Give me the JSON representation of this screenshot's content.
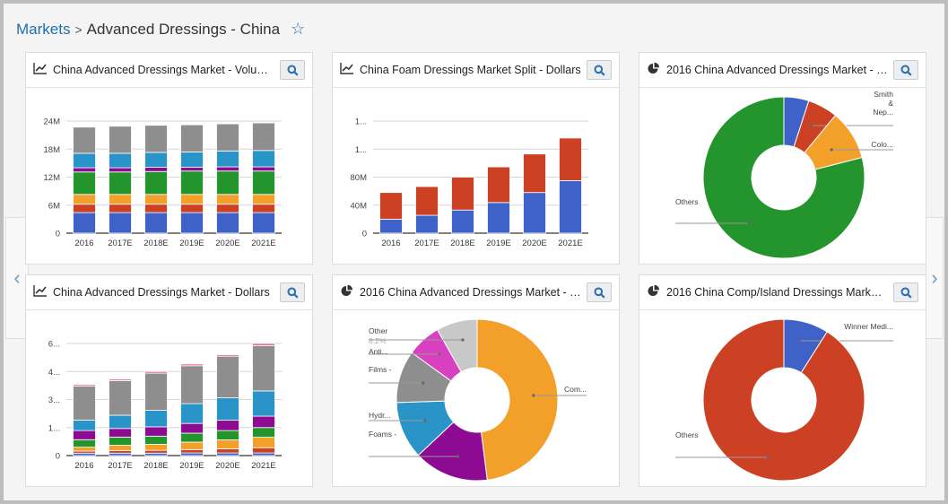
{
  "breadcrumb": {
    "root": "Markets",
    "separator": ">",
    "current": "Advanced Dressings - China"
  },
  "icons": {
    "favorite": "star-outline-icon",
    "line_chart": "line-chart-icon",
    "pie_chart": "pie-chart-icon",
    "search": "search-icon",
    "prev": "chevron-left-icon",
    "next": "chevron-right-icon"
  },
  "nav": {
    "prev": "‹",
    "next": "›",
    "star": "☆"
  },
  "cards": [
    {
      "title": "China Advanced Dressings Market - Volumes"
    },
    {
      "title": "China Foam Dressings Market Split - Dollars"
    },
    {
      "title": "2016 China Advanced Dressings Market - Revenue"
    },
    {
      "title": "China Advanced Dressings Market - Dollars"
    },
    {
      "title": "2016 China Advanced Dressings Market - Segment"
    },
    {
      "title": "2016 China Comp/Island Dressings Market - Revenue"
    }
  ],
  "chart_data": [
    {
      "type": "bar",
      "stacked": true,
      "title": "China Advanced Dressings Market - Volumes",
      "categories": [
        "2016",
        "2017E",
        "2018E",
        "2019E",
        "2020E",
        "2021E"
      ],
      "ylim": [
        0,
        24
      ],
      "yticks": [
        0,
        6,
        12,
        18,
        24
      ],
      "ytick_labels": [
        "0",
        "6M",
        "12M",
        "18M",
        "24M"
      ],
      "grid": true,
      "series": [
        {
          "name": "s1",
          "color": "#3e62c8",
          "values": [
            4.4,
            4.4,
            4.4,
            4.4,
            4.4,
            4.4
          ]
        },
        {
          "name": "s2",
          "color": "#cc4123",
          "values": [
            1.8,
            1.8,
            1.8,
            1.8,
            1.8,
            1.8
          ]
        },
        {
          "name": "s3",
          "color": "#f3a02a",
          "values": [
            2.1,
            2.1,
            2.1,
            2.1,
            2.1,
            2.1
          ]
        },
        {
          "name": "s4",
          "color": "#24942c",
          "values": [
            4.8,
            4.8,
            4.9,
            5.0,
            5.0,
            5.0
          ]
        },
        {
          "name": "s5",
          "color": "#8d0b93",
          "values": [
            0.9,
            0.9,
            0.9,
            0.8,
            0.9,
            0.9
          ]
        },
        {
          "name": "s6",
          "color": "#2a93c8",
          "values": [
            3.1,
            3.1,
            3.2,
            3.3,
            3.4,
            3.5
          ]
        },
        {
          "name": "s7",
          "color": "#8e8e8e",
          "values": [
            5.6,
            5.8,
            5.8,
            5.8,
            5.8,
            5.9
          ]
        }
      ]
    },
    {
      "type": "bar",
      "stacked": true,
      "title": "China Foam Dressings Market Split - Dollars",
      "categories": [
        "2016",
        "2017E",
        "2018E",
        "2019E",
        "2020E",
        "2021E"
      ],
      "ylim": [
        0,
        160
      ],
      "yticks": [
        0,
        40,
        80,
        120,
        160
      ],
      "ytick_labels": [
        "0",
        "40M",
        "80M",
        "1...",
        "1..."
      ],
      "grid": true,
      "series": [
        {
          "name": "s1",
          "color": "#3e62c8",
          "values": [
            20,
            25.5,
            33,
            43.7,
            58,
            75
          ]
        },
        {
          "name": "s2",
          "color": "#cc4123",
          "values": [
            38,
            41,
            47,
            50.9,
            55,
            60.8
          ]
        }
      ]
    },
    {
      "type": "pie",
      "donut": true,
      "title": "2016 China Advanced Dressings Market - Revenue",
      "slices": [
        {
          "label": "",
          "value": 5,
          "color": "#3e62c8"
        },
        {
          "label": "Smith & Nep...",
          "value": 6,
          "color": "#cc4123"
        },
        {
          "label": "Colo...",
          "value": 10,
          "color": "#f3a02a"
        },
        {
          "label": "Others",
          "value": 79,
          "color": "#24942c"
        }
      ]
    },
    {
      "type": "bar",
      "stacked": true,
      "title": "China Advanced Dressings Market - Dollars",
      "categories": [
        "2016",
        "2017E",
        "2018E",
        "2019E",
        "2020E",
        "2021E"
      ],
      "ylim": [
        0,
        6
      ],
      "yticks": [
        0,
        1.5,
        3,
        4.5,
        6
      ],
      "ytick_labels": [
        "0",
        "1...",
        "3...",
        "4...",
        "6..."
      ],
      "grid": true,
      "series": [
        {
          "name": "s1",
          "color": "#3e62c8",
          "values": [
            0.13,
            0.13,
            0.13,
            0.14,
            0.14,
            0.14
          ]
        },
        {
          "name": "s2",
          "color": "#cc4123",
          "values": [
            0.11,
            0.14,
            0.15,
            0.18,
            0.22,
            0.28
          ]
        },
        {
          "name": "s3",
          "color": "#f3a02a",
          "values": [
            0.21,
            0.28,
            0.32,
            0.4,
            0.48,
            0.56
          ]
        },
        {
          "name": "s4",
          "color": "#24942c",
          "values": [
            0.4,
            0.44,
            0.44,
            0.48,
            0.5,
            0.52
          ]
        },
        {
          "name": "s5",
          "color": "#8d0b93",
          "values": [
            0.49,
            0.46,
            0.5,
            0.52,
            0.55,
            0.61
          ]
        },
        {
          "name": "s6",
          "color": "#2a93c8",
          "values": [
            0.56,
            0.71,
            0.88,
            1.06,
            1.2,
            1.35
          ]
        },
        {
          "name": "s7",
          "color": "#8e8e8e",
          "values": [
            1.82,
            1.85,
            1.99,
            2.03,
            2.23,
            2.43
          ]
        },
        {
          "name": "s8",
          "color": "#e75b9e",
          "values": [
            0.08,
            0.08,
            0.09,
            0.09,
            0.08,
            0.11
          ]
        }
      ]
    },
    {
      "type": "pie",
      "donut": true,
      "title": "2016 China Advanced Dressings Market - Segment",
      "slices": [
        {
          "label": "Com...",
          "value": 48,
          "color": "#f3a02a"
        },
        {
          "label": "Foams -",
          "value": 15,
          "color": "#8d0b93"
        },
        {
          "label": "Hydr...",
          "value": 11.5,
          "color": "#2a93c8"
        },
        {
          "label": "Films -",
          "value": 10.5,
          "color": "#8e8e8e"
        },
        {
          "label": "Anti...",
          "value": 6.8,
          "color": "#d940c0"
        },
        {
          "label": "Other",
          "sublabel": "8.2%",
          "value": 8.2,
          "color": "#c8c8c8"
        }
      ]
    },
    {
      "type": "pie",
      "donut": true,
      "title": "2016 China Comp/Island Dressings Market - Revenue",
      "slices": [
        {
          "label": "Winner Medi...",
          "value": 9,
          "color": "#3e62c8"
        },
        {
          "label": "Others",
          "value": 91,
          "color": "#cc4123"
        }
      ]
    }
  ]
}
